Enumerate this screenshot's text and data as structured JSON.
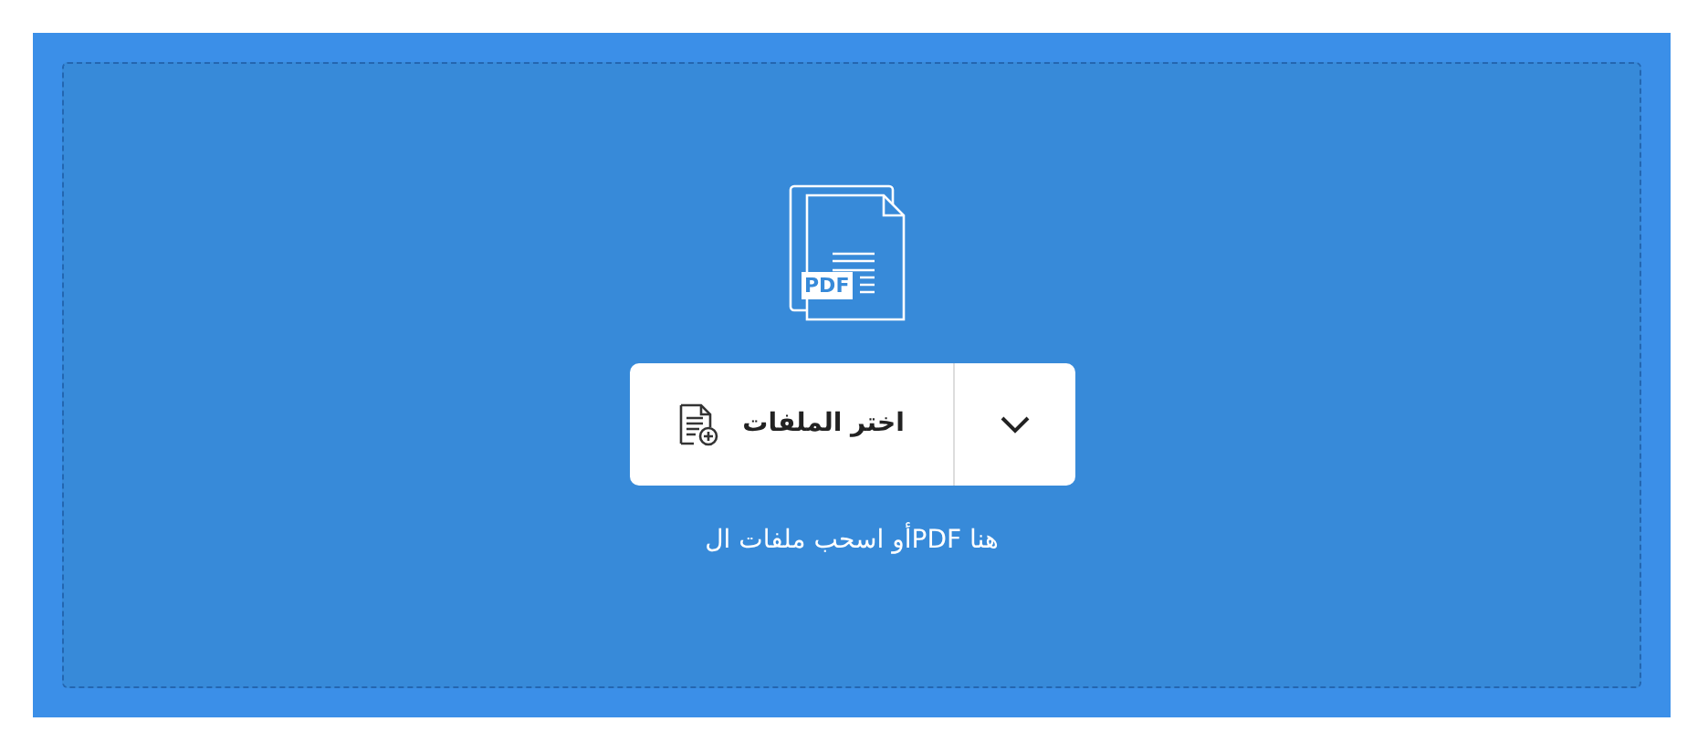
{
  "upload": {
    "icon_badge": "PDF",
    "choose_button": "اختر الملفات",
    "hint": "هنا PDFأو اسحب ملفات ال"
  }
}
